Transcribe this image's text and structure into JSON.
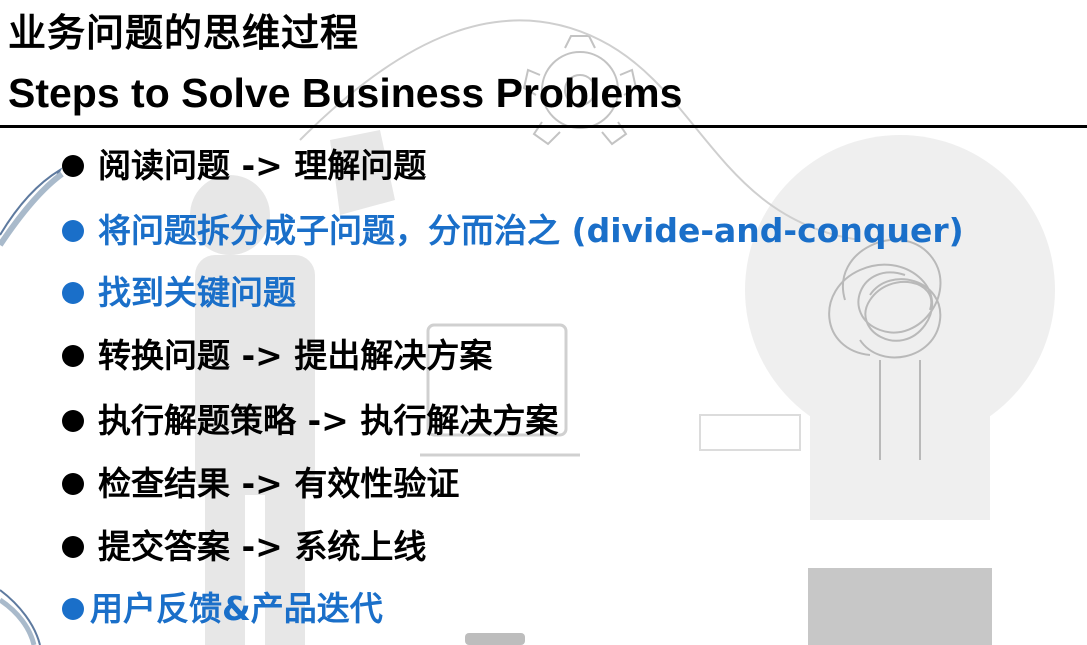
{
  "title": "业务问题的思维过程",
  "subtitle": "Steps to Solve Business Problems",
  "colors": {
    "black": "#000000",
    "accent_blue": "#1a6fc9",
    "illustration_gray": "#b7b7b7"
  },
  "bullets": [
    {
      "text": "阅读问题 -> 理解问题",
      "color": "#000000"
    },
    {
      "text": "将问题拆分成子问题，分而治之 (divide-and-conquer)",
      "color": "#1a6fc9"
    },
    {
      "text": "找到关键问题",
      "color": "#1a6fc9"
    },
    {
      "text": "转换问题 -> 提出解决方案",
      "color": "#000000"
    },
    {
      "text": "执行解题策略 ->  执行解决方案",
      "color": "#000000"
    },
    {
      "text": "检查结果 -> 有效性验证",
      "color": "#000000"
    },
    {
      "text": "提交答案 -> 系统上线",
      "color": "#000000"
    },
    {
      "text": "用户反馈&产品迭代",
      "color": "#1a6fc9"
    }
  ]
}
